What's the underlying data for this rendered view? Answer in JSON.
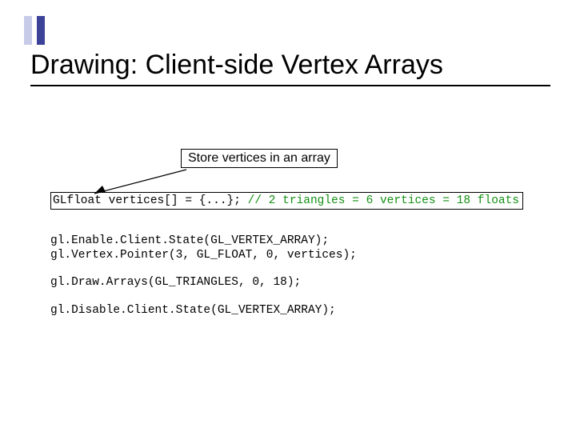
{
  "title": "Drawing:  Client-side Vertex Arrays",
  "caption": "Store vertices in an array",
  "code": {
    "decl_a": "GLfloat vertices[] = {...}; ",
    "decl_b": "// 2 triangles = 6 vertices = 18 floats",
    "enable": "gl.Enable.Client.State(GL_VERTEX_ARRAY);",
    "pointer": "gl.Vertex.Pointer(3, GL_FLOAT, 0, vertices);",
    "draw": "gl.Draw.Arrays(GL_TRIANGLES, 0, 18);",
    "disable": "gl.Disable.Client.State(GL_VERTEX_ARRAY);"
  }
}
